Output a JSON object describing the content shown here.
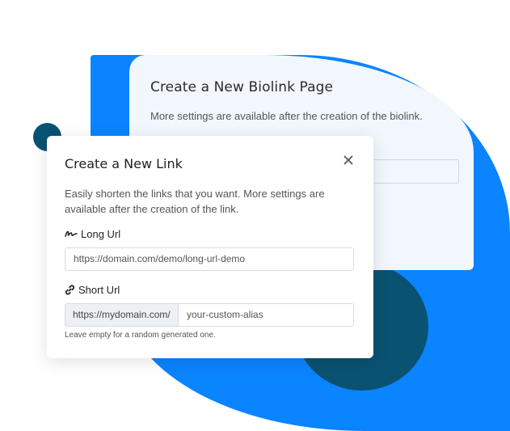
{
  "biolink_card": {
    "title": "Create a New Biolink Page",
    "description": "More settings are available after the creation of the biolink."
  },
  "link_card": {
    "title": "Create a New Link",
    "close_icon": "close-icon",
    "description": "Easily shorten the links that you want. More settings are available after the creation of the link.",
    "long_url": {
      "label": "Long Url",
      "icon": "signature-icon",
      "value": "https://domain.com/demo/long-url-demo"
    },
    "short_url": {
      "label": "Short Url",
      "icon": "link-icon",
      "prefix": "https://mydomain.com/",
      "placeholder": "your-custom-alias",
      "help": "Leave empty for a random generated one."
    }
  },
  "colors": {
    "accent_blue": "#0a84ff",
    "dark_teal": "#0a5272",
    "back_card": "#f1f7fd"
  }
}
